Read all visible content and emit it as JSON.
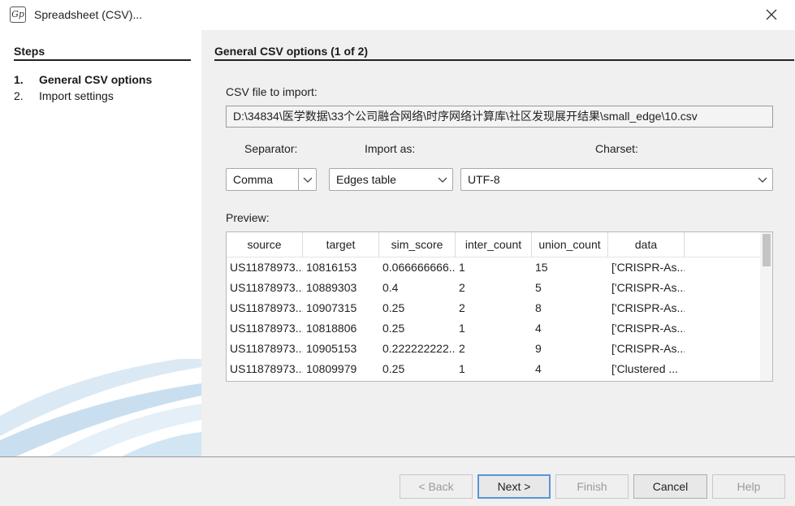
{
  "window": {
    "title": "Spreadsheet (CSV)..."
  },
  "sidebar": {
    "heading": "Steps",
    "steps": [
      {
        "num": "1.",
        "label": "General CSV options"
      },
      {
        "num": "2.",
        "label": "Import settings"
      }
    ]
  },
  "main": {
    "heading": "General CSV options (1 of 2)",
    "file_label": "CSV file to import:",
    "file_path": "D:\\34834\\医学数据\\33个公司融合网络\\时序网络计算库\\社区发现展开结果\\small_edge\\10.csv",
    "separator": {
      "label": "Separator:",
      "value": "Comma"
    },
    "import_as": {
      "label": "Import as:",
      "value": "Edges table"
    },
    "charset": {
      "label": "Charset:",
      "value": "UTF-8"
    },
    "preview_label": "Preview:",
    "preview": {
      "columns": [
        "source",
        "target",
        "sim_score",
        "inter_count",
        "union_count",
        "data"
      ],
      "rows": [
        [
          "US11878973...",
          "10816153",
          "0.066666666...",
          "1",
          "15",
          "['CRISPR-As..."
        ],
        [
          "US11878973...",
          "10889303",
          "0.4",
          "2",
          "5",
          "['CRISPR-As..."
        ],
        [
          "US11878973...",
          "10907315",
          "0.25",
          "2",
          "8",
          "['CRISPR-As..."
        ],
        [
          "US11878973...",
          "10818806",
          "0.25",
          "1",
          "4",
          "['CRISPR-As..."
        ],
        [
          "US11878973...",
          "10905153",
          "0.222222222...",
          "2",
          "9",
          "['CRISPR-As..."
        ],
        [
          "US11878973...",
          "10809979",
          "0.25",
          "1",
          "4",
          "['Clustered ..."
        ]
      ]
    }
  },
  "buttons": {
    "back": "< Back",
    "next": "Next >",
    "finish": "Finish",
    "cancel": "Cancel",
    "help": "Help"
  }
}
